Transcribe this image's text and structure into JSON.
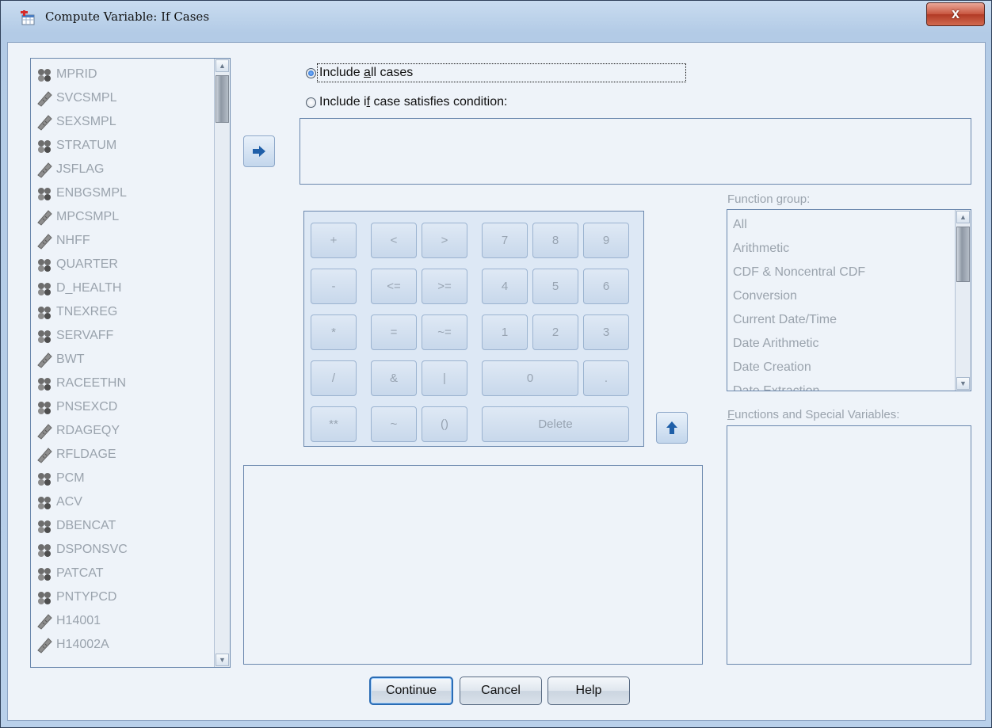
{
  "window": {
    "title": "Compute Variable: If Cases",
    "close_label": "x"
  },
  "variables": [
    {
      "name": "MPRID",
      "kind": "nominal"
    },
    {
      "name": "SVCSMPL",
      "kind": "scale"
    },
    {
      "name": "SEXSMPL",
      "kind": "scale"
    },
    {
      "name": "STRATUM",
      "kind": "nominal"
    },
    {
      "name": "JSFLAG",
      "kind": "scale"
    },
    {
      "name": "ENBGSMPL",
      "kind": "nominal"
    },
    {
      "name": "MPCSMPL",
      "kind": "scale"
    },
    {
      "name": "NHFF",
      "kind": "scale"
    },
    {
      "name": "QUARTER",
      "kind": "nominal"
    },
    {
      "name": "D_HEALTH",
      "kind": "nominal"
    },
    {
      "name": "TNEXREG",
      "kind": "nominal"
    },
    {
      "name": "SERVAFF",
      "kind": "nominal"
    },
    {
      "name": "BWT",
      "kind": "scale"
    },
    {
      "name": "RACEETHN",
      "kind": "nominal"
    },
    {
      "name": "PNSEXCD",
      "kind": "nominal"
    },
    {
      "name": "RDAGEQY",
      "kind": "scale"
    },
    {
      "name": "RFLDAGE",
      "kind": "scale"
    },
    {
      "name": "PCM",
      "kind": "nominal"
    },
    {
      "name": "ACV",
      "kind": "nominal"
    },
    {
      "name": "DBENCAT",
      "kind": "nominal"
    },
    {
      "name": "DSPONSVC",
      "kind": "nominal"
    },
    {
      "name": "PATCAT",
      "kind": "nominal"
    },
    {
      "name": "PNTYPCD",
      "kind": "nominal"
    },
    {
      "name": "H14001",
      "kind": "scale"
    },
    {
      "name": "H14002A",
      "kind": "scale"
    }
  ],
  "options": {
    "all_cases": {
      "pre": "Include ",
      "key": "a",
      "post": "ll cases",
      "selected": true
    },
    "condition": {
      "pre": "Include i",
      "key": "f",
      "post": " case satisfies condition:",
      "selected": false
    }
  },
  "keypad": {
    "keys": [
      "+",
      "<",
      ">",
      "7",
      "8",
      "9",
      "-",
      "<=",
      ">=",
      "4",
      "5",
      "6",
      "*",
      "=",
      "~=",
      "1",
      "2",
      "3",
      "/",
      "&",
      "|",
      "0",
      ".",
      "**",
      "~",
      "()",
      "Delete"
    ]
  },
  "function_group": {
    "label_pre": "Function ",
    "label_key": "g",
    "label_post": "roup:",
    "items": [
      "All",
      "Arithmetic",
      "CDF & Noncentral CDF",
      "Conversion",
      "Current Date/Time",
      "Date Arithmetic",
      "Date Creation",
      "Date Extraction"
    ]
  },
  "functions": {
    "label_key": "F",
    "label_post": "unctions and Special Variables:"
  },
  "buttons": {
    "continue": "Continue",
    "cancel": "Cancel",
    "help": "Help"
  }
}
